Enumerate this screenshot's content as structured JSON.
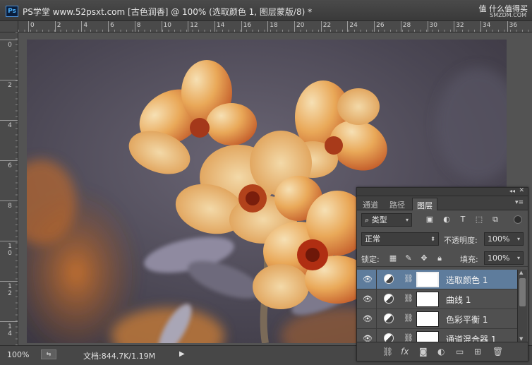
{
  "app": {
    "logo_text": "Ps",
    "document_title": "PS学堂 www.52psxt.com [古色润香] @ 100% (选取颜色 1, 图层蒙版/8) *"
  },
  "watermark": {
    "logo": "值 什么值得买",
    "url": "SMZDM.COM"
  },
  "rulers": {
    "horizontal": [
      "0",
      "2",
      "4",
      "6",
      "8",
      "10",
      "12",
      "14",
      "16",
      "18",
      "20",
      "22",
      "24",
      "26",
      "28",
      "30",
      "32",
      "34",
      "36"
    ],
    "vertical": [
      "0",
      "2",
      "4",
      "6",
      "8",
      "10",
      "12",
      "14"
    ]
  },
  "status": {
    "zoom": "100%",
    "doc_size": "文档:844.7K/1.19M"
  },
  "layers_panel": {
    "tabs": [
      {
        "label": "通道",
        "active": false
      },
      {
        "label": "路径",
        "active": false
      },
      {
        "label": "图层",
        "active": true
      }
    ],
    "filter_kind": "类型",
    "blend_mode": "正常",
    "opacity_label": "不透明度:",
    "opacity_value": "100%",
    "lock_label": "锁定:",
    "fill_label": "填充:",
    "fill_value": "100%",
    "layers": [
      {
        "name": "选取颜色 1",
        "visible": true,
        "selected": true
      },
      {
        "name": "曲线 1",
        "visible": true,
        "selected": false
      },
      {
        "name": "色彩平衡 1",
        "visible": true,
        "selected": false
      },
      {
        "name": "通道混合器 1",
        "visible": true,
        "selected": false
      }
    ]
  },
  "colors": {
    "panel_bg": "#505050",
    "selected_layer": "#5e7c9c",
    "chrome": "#535353"
  }
}
